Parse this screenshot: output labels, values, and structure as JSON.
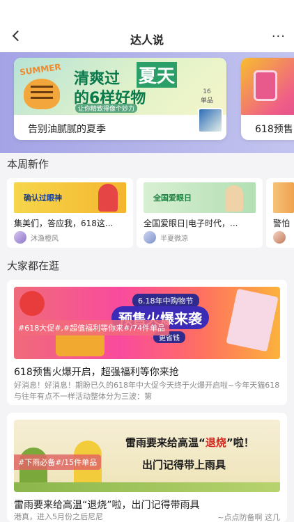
{
  "header": {
    "title": "达人说",
    "more": "···"
  },
  "hero": {
    "card1": {
      "summer": "SUMMER",
      "line1a": "清爽过",
      "line1b": "夏天",
      "line2": "的6样好物",
      "line3": "让你精致得像个妙力",
      "count": "16",
      "count_unit": "单品",
      "caption": "告别油腻腻的夏季"
    },
    "card2": {
      "caption": "618预售"
    }
  },
  "sections": {
    "new_works": "本周新作",
    "trending": "大家都在逛"
  },
  "new_works": [
    {
      "image_text": "确认过眼神",
      "title": "集美们，答应我，618这...",
      "author": "沐渔橙风"
    },
    {
      "image_text": "全国爱眼日",
      "title": "全国爱眼日|电子时代，...",
      "author": "半夏微凉"
    },
    {
      "image_text": "",
      "title": "警怕",
      "author": ""
    }
  ],
  "feed": [
    {
      "promo_date": "6.18年中购物节",
      "promo_title": "预售火爆来袭",
      "promo_sub": "更省钱",
      "tag": "#618大促#,#超值福利等你来#/74件单品",
      "title": "618预售火爆开启，超强福利等你来抢",
      "desc": "好消息！好消息！期盼已久的618年中大促今天终于火爆开启啦~今年天猫618与往年有点不一样活动整体分为三波：第"
    },
    {
      "img_line1a": "雷雨要来给高温“",
      "img_line1b": "退烧",
      "img_line1c": "”啦！",
      "img_line2": "出门记得带上雨具",
      "tag": "#下雨必备#/15件单品",
      "title": "雷雨要来给高温“退烧”啦，出门记得带雨具",
      "desc": "港真，进入5月份之后尼尼",
      "desc_right": "~点点防备啊 这几"
    }
  ]
}
